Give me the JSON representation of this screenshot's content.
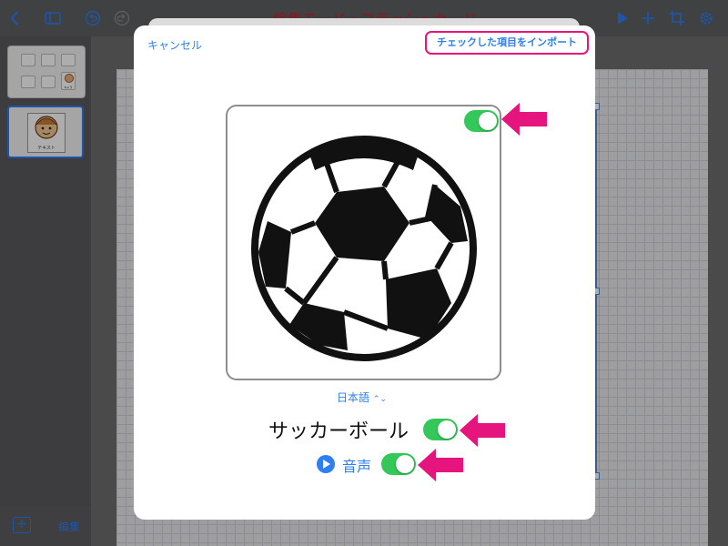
{
  "app": {
    "title": "編集モード・フラッシュカード",
    "accent": "#2d7ef7",
    "title_color": "#b2323a"
  },
  "toolbar": {
    "left_icons": [
      "chevron-left-icon",
      "sidebar-icon",
      "undo-icon",
      "redo-icon"
    ],
    "right_icons": [
      "play-icon",
      "plus-icon",
      "crop-icon",
      "gear-icon"
    ]
  },
  "sidebar": {
    "thumbnails": [
      {
        "label": "キャラ"
      },
      {
        "label": "テキスト"
      }
    ],
    "add_label": "+",
    "edit_label": "編集"
  },
  "modal": {
    "cancel_label": "キャンセル",
    "import_label": "チェックした項目をインポート",
    "image": {
      "icon": "soccer-ball-icon",
      "include": true
    },
    "language": {
      "value": "日本語",
      "chevron": "⌃⌄"
    },
    "word": {
      "text": "サッカーボール",
      "include": true
    },
    "audio": {
      "label": "音声",
      "include": true,
      "icon": "play-circle-icon"
    },
    "highlight_color": "#e6157e",
    "toggle_on_color": "#34c759"
  }
}
